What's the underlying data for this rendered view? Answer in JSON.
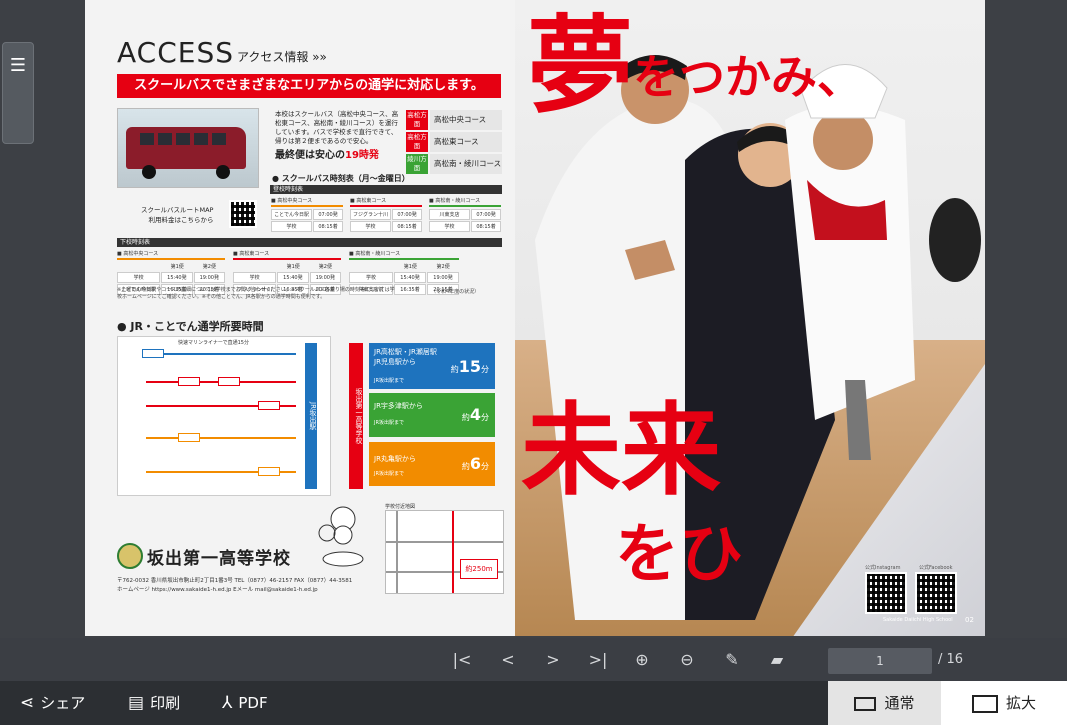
{
  "brochure": {
    "access_title": "ACCESS",
    "access_sub": "アクセス情報 »»",
    "banner": "スクールバスでさまざまなエリアからの通学に対応します。",
    "intro": "本校はスクールバス（高松中央コース、高松東コース、高松南・綾川コース）を運行しています。バスで学校まで直行できて、帰りは第２便まであるので安心。",
    "last_bus_prefix": "最終便は安心の",
    "last_bus_time": "19時発",
    "routes": [
      {
        "tag": "高松方面",
        "name": "高松中央コース",
        "color": "#e60012"
      },
      {
        "tag": "高松方面",
        "name": "高松東コース",
        "color": "#e60012"
      },
      {
        "tag": "綾川方面",
        "name": "高松南・綾川コース",
        "color": "#3aa335"
      }
    ],
    "map_label_1": "スクールバスルートMAP",
    "map_label_2": "利用料金はこちらから",
    "schedule_title": "● スクールバス時刻表（月～金曜日）",
    "up_label": "登校時刻表",
    "down_label": "下校時刻表",
    "up_cols": [
      {
        "head": "■ 高松中央コース",
        "color": "#f28c00",
        "rows": [
          [
            "ことでん今日駅",
            "07:00発"
          ],
          [
            "学校",
            "08:15着"
          ]
        ]
      },
      {
        "head": "■ 高松東コース",
        "color": "#e60012",
        "rows": [
          [
            "フジグラン十川",
            "07:00発"
          ],
          [
            "学校",
            "08:15着"
          ]
        ]
      },
      {
        "head": "■ 高松南・綾川コース",
        "color": "#3aa335",
        "rows": [
          [
            "川東支店",
            "07:00発"
          ],
          [
            "学校",
            "08:15着"
          ]
        ]
      }
    ],
    "down_cols": [
      {
        "head": "■ 高松中央コース",
        "color": "#f28c00",
        "rows": [
          [
            "",
            "第1便",
            "第2便"
          ],
          [
            "学校",
            "15:40発",
            "19:00発"
          ],
          [
            "ことでん今日駅",
            "16:35着",
            "20:15着"
          ]
        ]
      },
      {
        "head": "■ 高松東コース",
        "color": "#e60012",
        "rows": [
          [
            "",
            "第1便",
            "第2便"
          ],
          [
            "学校",
            "15:40発",
            "19:00発"
          ],
          [
            "フジグラン十川",
            "16:35着",
            "20:15着"
          ]
        ]
      },
      {
        "head": "■ 高松南・綾川コース",
        "color": "#3aa335",
        "rows": [
          [
            "",
            "第1便",
            "第2便"
          ],
          [
            "学校",
            "15:40発",
            "19:00発"
          ],
          [
            "川東支店前",
            "16:35着",
            "20:15着"
          ]
        ]
      }
    ],
    "notes": "※土曜日の時刻表やコースの詳細については学校までお問い合わせください。※スクールバス各乗り場の時刻等については学校ホームページにてご確認ください。※その他ことでん、JR各駅からの通学時間も便利です。",
    "notes_date": "（令和4年度の状況）",
    "jr_title": "● JR・ことでん通学所要時間",
    "jr_cards": [
      {
        "title": "JR高松駅・JR瀬居駅\nJR児島駅から",
        "sub": "JR坂出駅まで",
        "prefix": "約",
        "num": "15",
        "unit": "分",
        "color": "#1e73be"
      },
      {
        "title": "JR宇多津駅から",
        "sub": "JR坂出駅まで",
        "prefix": "約",
        "num": "4",
        "unit": "分",
        "color": "#3aa335"
      },
      {
        "title": "JR丸亀駅から",
        "sub": "JR坂出駅まで",
        "prefix": "約",
        "num": "6",
        "unit": "分",
        "color": "#f28c00"
      }
    ],
    "jr_station": "JR坂出駅",
    "school_vertical": "坂出第一高等学校",
    "rapid_label": "快速マリンライナーで直通15分",
    "school_name": "坂出第一高等学校",
    "address": "〒762-0032 香川県坂出市駒止町2丁目1番3号  TEL（0877）46-2157  FAX（0877）44-3581",
    "web": "ホームページ https://www.sakaide1-h.ed.jp    Eメール mail@sakaide1-h.ed.jp",
    "area_map_label": "学校付近地図",
    "walk": "約250m",
    "heading_large_1": "夢",
    "heading_small_1": "をつかみ、",
    "heading_large_2": "未来",
    "heading_small_2": "をひ",
    "instagram": "公式Instagram",
    "facebook": "公式Facebook",
    "footer_school": "Sakaide Daiichi High School",
    "page_number": "02"
  },
  "toolbar": {
    "first_icon": "|<",
    "prev_icon": "<",
    "next_icon": ">",
    "last_icon": ">|",
    "zoom_in_icon": "⊕",
    "zoom_out_icon": "⊖",
    "pen_icon": "✎",
    "eraser_icon": "▰",
    "page_value": "1",
    "page_total": "/ 16"
  },
  "bottom": {
    "share": "シェア",
    "print": "印刷",
    "pdf": "PDF",
    "view_normal": "通常",
    "view_zoom": "拡大"
  }
}
